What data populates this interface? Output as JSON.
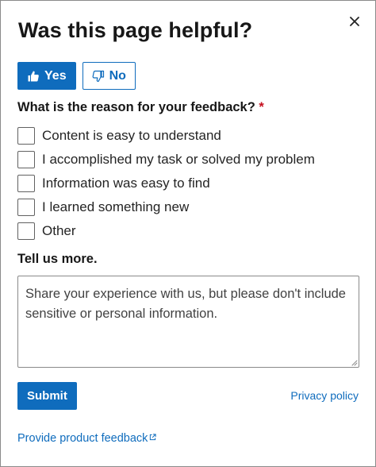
{
  "dialog": {
    "title": "Was this page helpful?",
    "close_icon": "close-icon"
  },
  "rating": {
    "yes_label": "Yes",
    "yes_icon": "thumbs-up-icon",
    "no_label": "No",
    "no_icon": "thumbs-down-icon",
    "selected": "Yes"
  },
  "feedback": {
    "question": "What is the reason for your feedback?",
    "required_marker": "*",
    "options": [
      {
        "label": "Content is easy to understand",
        "checked": false
      },
      {
        "label": "I accomplished my task or solved my problem",
        "checked": false
      },
      {
        "label": "Information was easy to find",
        "checked": false
      },
      {
        "label": "I learned something new",
        "checked": false
      },
      {
        "label": "Other",
        "checked": false
      }
    ]
  },
  "details": {
    "heading": "Tell us more.",
    "placeholder": "Share your experience with us, but please don't include sensitive or personal information.",
    "value": ""
  },
  "actions": {
    "submit_label": "Submit",
    "privacy_label": "Privacy policy",
    "product_feedback_label": "Provide product feedback",
    "external_link_icon": "external-link-icon"
  },
  "colors": {
    "accent": "#0f6cbd",
    "required": "#c50f1f",
    "text": "#171717",
    "border": "#8a8a8a"
  }
}
